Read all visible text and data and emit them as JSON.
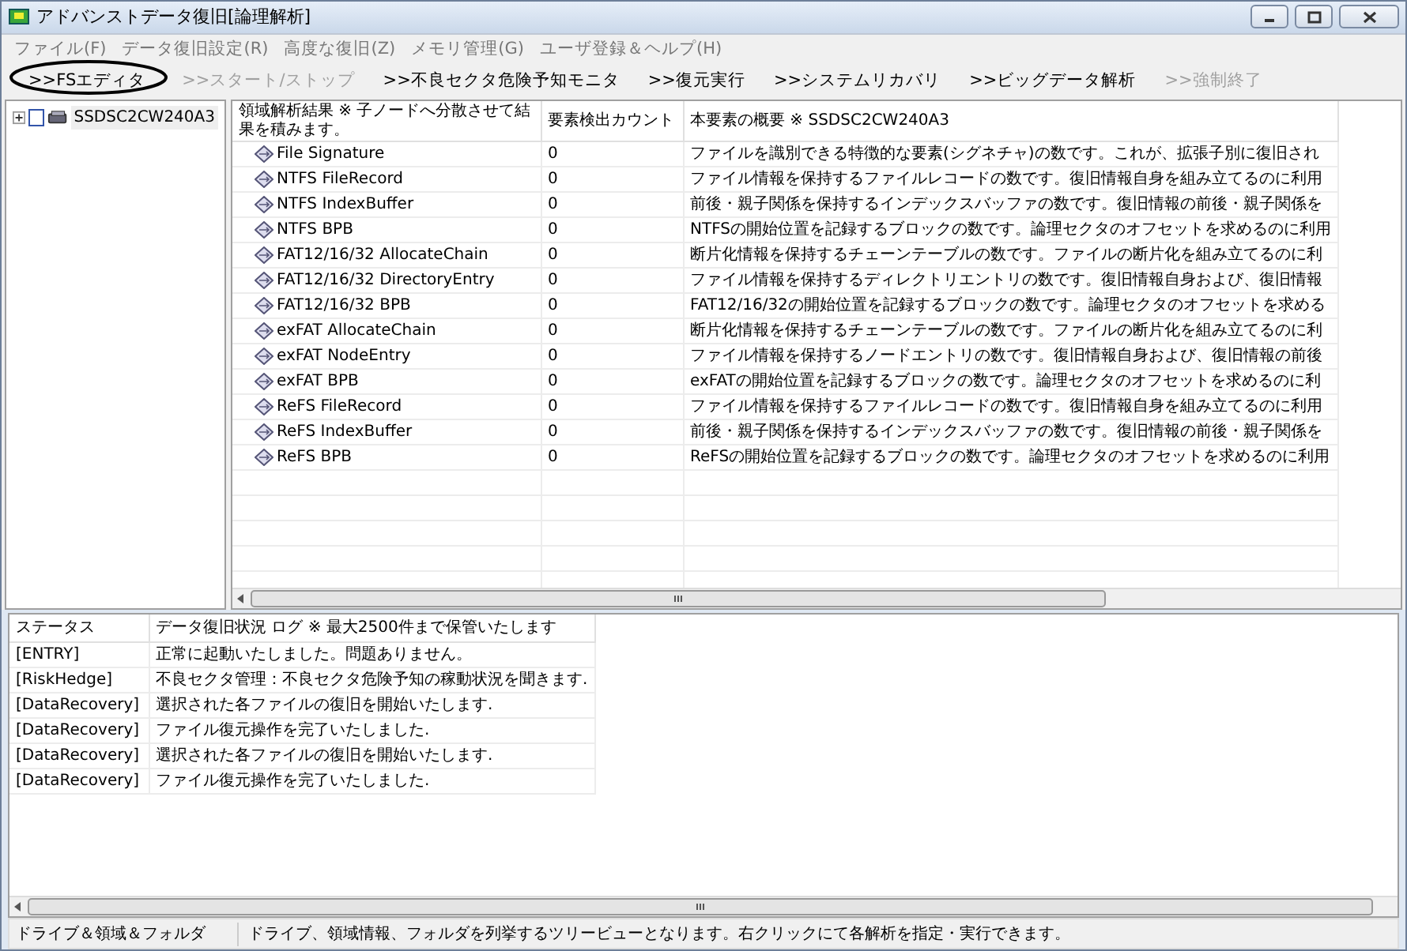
{
  "window": {
    "title": "アドバンストデータ復旧[論理解析]"
  },
  "menu": [
    "ファイル(F)",
    "データ復旧設定(R)",
    "高度な復旧(Z)",
    "メモリ管理(G)",
    "ユーザ登録＆ヘルプ(H)"
  ],
  "toolbar": [
    {
      "label": ">>FSエディタ",
      "disabled": false
    },
    {
      "label": ">>スタート/ストップ",
      "disabled": true
    },
    {
      "label": ">>不良セクタ危険予知モニタ",
      "disabled": false
    },
    {
      "label": ">>復元実行",
      "disabled": false
    },
    {
      "label": ">>システムリカバリ",
      "disabled": false
    },
    {
      "label": ">>ビッグデータ解析",
      "disabled": false
    },
    {
      "label": ">>強制終了",
      "disabled": true
    }
  ],
  "tree": [
    {
      "label": "SSDSC2CW240A3",
      "checked": false,
      "expanded": false
    }
  ],
  "results": {
    "columns": [
      "領域解析結果 ※ 子ノードへ分散させて結果を積みます。",
      "要素検出カウント",
      "本要素の概要 ※ SSDSC2CW240A3"
    ],
    "rows": [
      {
        "name": "File Signature",
        "count": "0",
        "summary": "ファイルを識別できる特徴的な要素(シグネチャ)の数です。これが、拡張子別に復旧され"
      },
      {
        "name": "NTFS FileRecord",
        "count": "0",
        "summary": "ファイル情報を保持するファイルレコードの数です。復旧情報自身を組み立てるのに利用"
      },
      {
        "name": "NTFS IndexBuffer",
        "count": "0",
        "summary": "前後・親子関係を保持するインデックスバッファの数です。復旧情報の前後・親子関係を"
      },
      {
        "name": "NTFS BPB",
        "count": "0",
        "summary": "NTFSの開始位置を記録するブロックの数です。論理セクタのオフセットを求めるのに利用"
      },
      {
        "name": "FAT12/16/32 AllocateChain",
        "count": "0",
        "summary": "断片化情報を保持するチェーンテーブルの数です。ファイルの断片化を組み立てるのに利"
      },
      {
        "name": "FAT12/16/32 DirectoryEntry",
        "count": "0",
        "summary": "ファイル情報を保持するディレクトリエントリの数です。復旧情報自身および、復旧情報"
      },
      {
        "name": "FAT12/16/32 BPB",
        "count": "0",
        "summary": "FAT12/16/32の開始位置を記録するブロックの数です。論理セクタのオフセットを求める"
      },
      {
        "name": "exFAT AllocateChain",
        "count": "0",
        "summary": "断片化情報を保持するチェーンテーブルの数です。ファイルの断片化を組み立てるのに利"
      },
      {
        "name": "exFAT NodeEntry",
        "count": "0",
        "summary": "ファイル情報を保持するノードエントリの数です。復旧情報自身および、復旧情報の前後"
      },
      {
        "name": "exFAT BPB",
        "count": "0",
        "summary": "exFATの開始位置を記録するブロックの数です。論理セクタのオフセットを求めるのに利"
      },
      {
        "name": "ReFS FileRecord",
        "count": "0",
        "summary": "ファイル情報を保持するファイルレコードの数です。復旧情報自身を組み立てるのに利用"
      },
      {
        "name": "ReFS IndexBuffer",
        "count": "0",
        "summary": "前後・親子関係を保持するインデックスバッファの数です。復旧情報の前後・親子関係を"
      },
      {
        "name": "ReFS BPB",
        "count": "0",
        "summary": "ReFSの開始位置を記録するブロックの数です。論理セクタのオフセットを求めるのに利用"
      }
    ]
  },
  "log": {
    "columns": [
      "ステータス",
      "データ復旧状況 ログ ※ 最大2500件まで保管いたします"
    ],
    "rows": [
      {
        "status": "[ENTRY]",
        "message": "正常に起動いたしました。問題ありません。"
      },
      {
        "status": "[RiskHedge]",
        "message": "不良セクタ管理：不良セクタ危険予知の稼動状況を聞きます."
      },
      {
        "status": "[DataRecovery]",
        "message": "選択された各ファイルの復旧を開始いたします."
      },
      {
        "status": "[DataRecovery]",
        "message": "ファイル復元操作を完了いたしました."
      },
      {
        "status": "[DataRecovery]",
        "message": "選択された各ファイルの復旧を開始いたします."
      },
      {
        "status": "[DataRecovery]",
        "message": "ファイル復元操作を完了いたしました."
      }
    ]
  },
  "status_bar": [
    "ドライブ＆領域＆フォルダ",
    "ドライブ、領域情報、フォルダを列挙するツリービューとなります。右クリックにて各解析を指定・実行できます。"
  ]
}
